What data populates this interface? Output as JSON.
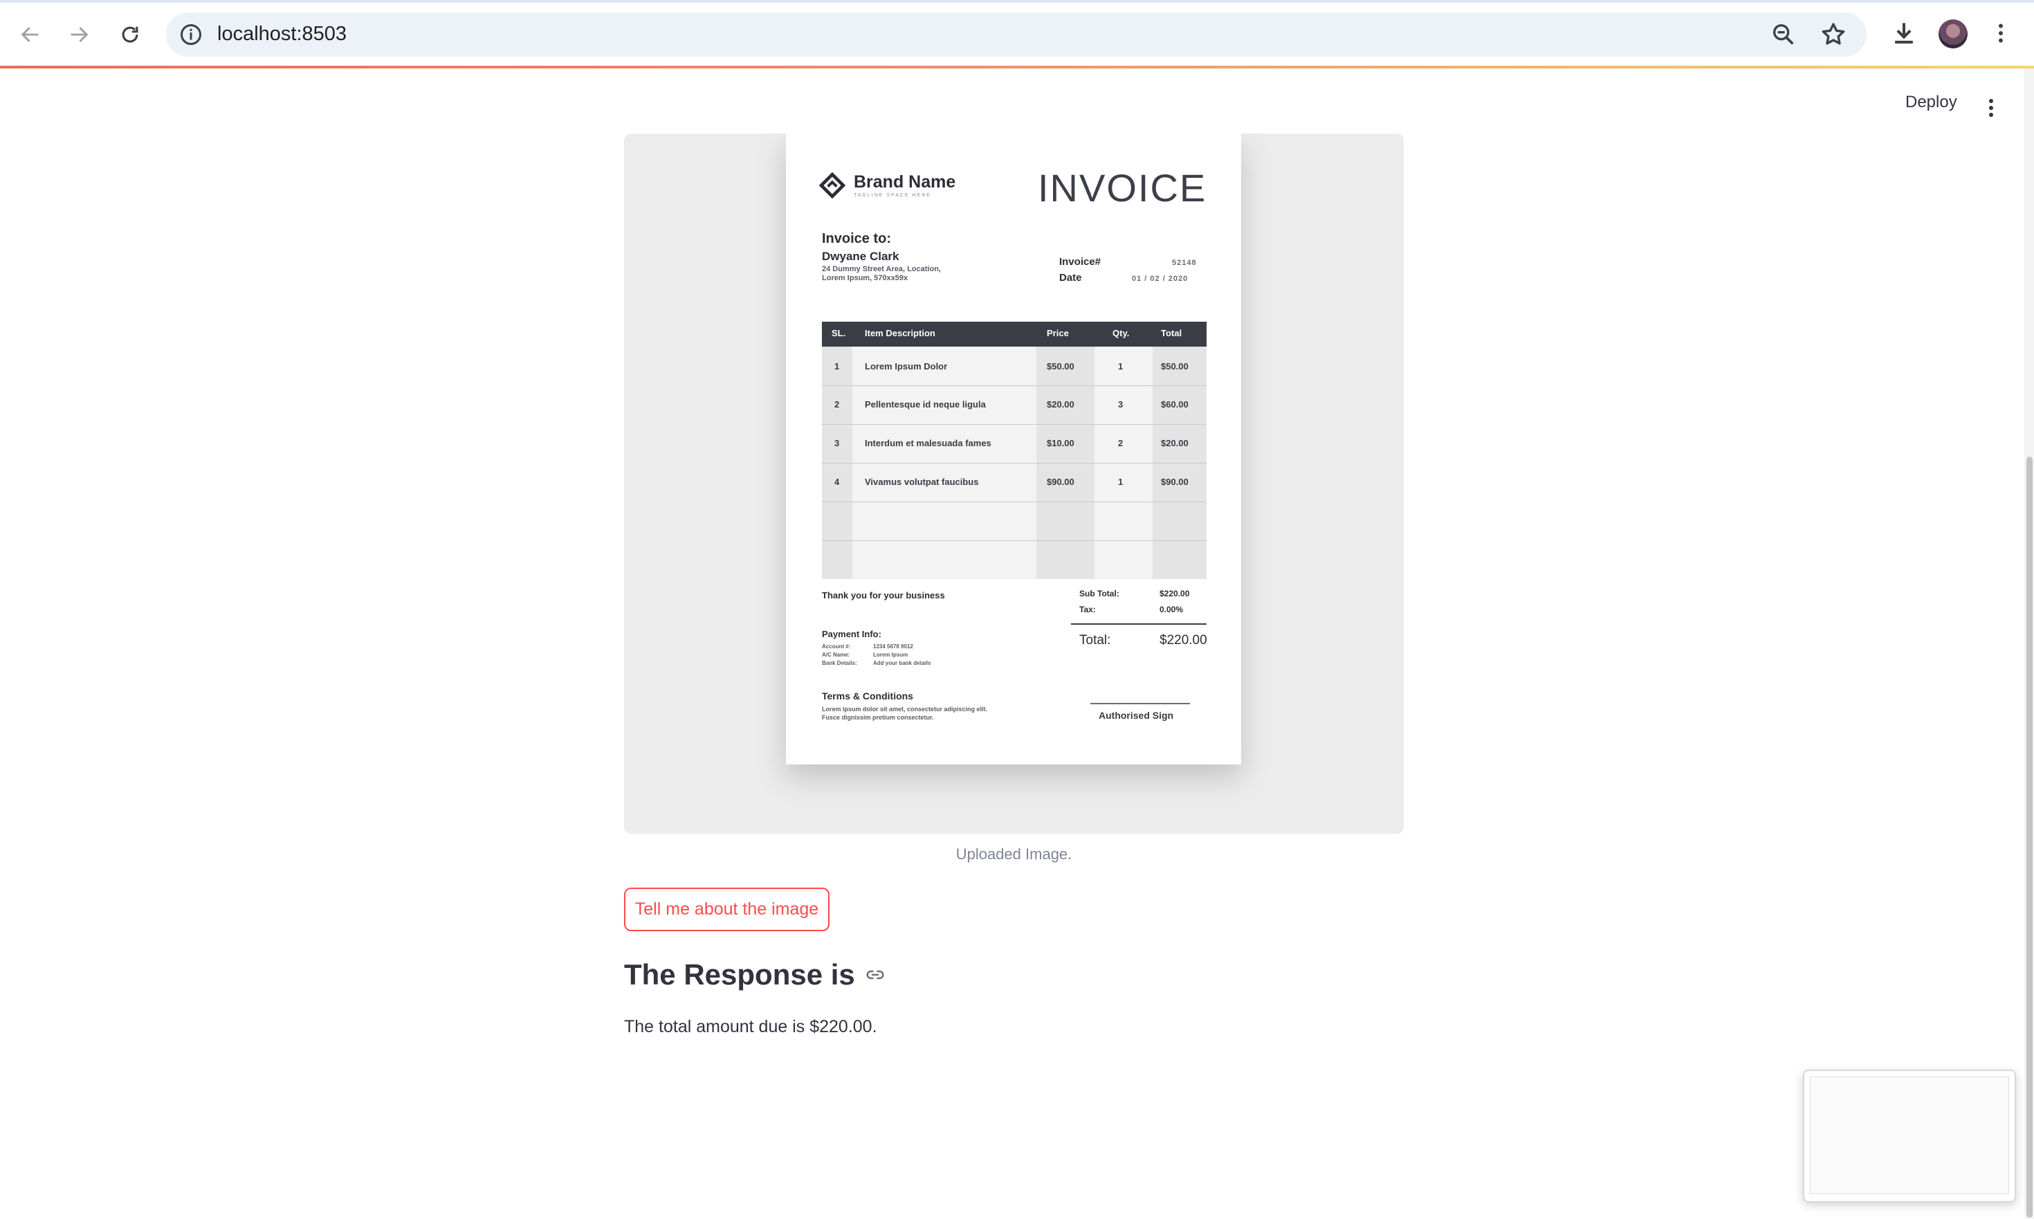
{
  "browser": {
    "url": "localhost:8503"
  },
  "app_header": {
    "deploy_label": "Deploy"
  },
  "invoice_image": {
    "brand_name": "Brand Name",
    "brand_tagline": "TAGLINE SPACE HERE",
    "title": "INVOICE",
    "invoice_to_label": "Invoice to:",
    "client_name": "Dwyane Clark",
    "client_address": "24 Dummy Street Area, Location, Lorem Ipsum, 570xx59x",
    "invoice_number_label": "Invoice#",
    "invoice_number": "52148",
    "date_label": "Date",
    "date": "01 / 02 / 2020",
    "columns": [
      "SL.",
      "Item Description",
      "Price",
      "Qty.",
      "Total"
    ],
    "items": [
      {
        "sl": "1",
        "desc": "Lorem Ipsum Dolor",
        "price": "$50.00",
        "qty": "1",
        "total": "$50.00"
      },
      {
        "sl": "2",
        "desc": "Pellentesque id neque ligula",
        "price": "$20.00",
        "qty": "3",
        "total": "$60.00"
      },
      {
        "sl": "3",
        "desc": "Interdum et malesuada fames",
        "price": "$10.00",
        "qty": "2",
        "total": "$20.00"
      },
      {
        "sl": "4",
        "desc": "Vivamus volutpat faucibus",
        "price": "$90.00",
        "qty": "1",
        "total": "$90.00"
      }
    ],
    "thanks": "Thank you for your business",
    "subtotal_label": "Sub Total:",
    "subtotal": "$220.00",
    "tax_label": "Tax:",
    "tax": "0.00%",
    "total_label": "Total:",
    "total": "$220.00",
    "payment_label": "Payment Info:",
    "payment_rows": [
      {
        "label": "Account #:",
        "value": "1234 5678 9012"
      },
      {
        "label": "A/C Name:",
        "value": "Lorem Ipsum"
      },
      {
        "label": "Bank Details:",
        "value": "Add your bank details"
      }
    ],
    "terms_label": "Terms & Conditions",
    "terms_text": "Lorem ipsum dolor sit amet, consectetur adipiscing elit. Fusce dignissim pretium consectetur.",
    "sign_label": "Authorised Sign"
  },
  "caption": "Uploaded Image.",
  "action_button": "Tell me about the image",
  "response_heading": "The Response is",
  "response_text": "The total amount due is $220.00."
}
